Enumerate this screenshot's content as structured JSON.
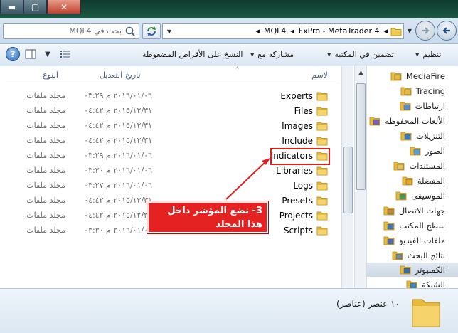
{
  "window": {
    "minimize_glyph": "▬",
    "maximize_glyph": "▢",
    "close_glyph": "✕"
  },
  "search": {
    "placeholder": "بحث في MQL4"
  },
  "address": {
    "crumbs": [
      "MQL4",
      "FxPro - MetaTrader 4"
    ],
    "separator": "◂"
  },
  "toolbar": {
    "organize": "تنظيم",
    "include_in_library": "تضمين في المكتبة",
    "share_with": "مشاركة مع",
    "burn": "النسخ على الأقراص المضغوطة"
  },
  "columns": {
    "name": "الاسم",
    "date_modified": "تاريخ التعديل",
    "type": "النوع",
    "sort_glyph": "^"
  },
  "files": [
    {
      "name": "Experts",
      "date": "٢٠١٦/٠١/٠٦ م ٠٣:٢٩",
      "type": "مجلد ملفات"
    },
    {
      "name": "Files",
      "date": "٢٠١٥/١٢/٣١ م ٠٤:٤٢",
      "type": "مجلد ملفات"
    },
    {
      "name": "Images",
      "date": "٢٠١٥/١٢/٣١ م ٠٤:٤٢",
      "type": "مجلد ملفات"
    },
    {
      "name": "Include",
      "date": "٢٠١٥/١٢/٣١ م ٠٤:٤٢",
      "type": "مجلد ملفات"
    },
    {
      "name": "Indicators",
      "date": "٢٠١٦/٠١/٠٦ م ٠٣:٢٩",
      "type": "مجلد ملفات"
    },
    {
      "name": "Libraries",
      "date": "٢٠١٦/٠١/٠٦ م ٠٣:٣٠",
      "type": "مجلد ملفات"
    },
    {
      "name": "Logs",
      "date": "٢٠١٦/٠١/٠٦ م ٠٣:٢٧",
      "type": "مجلد ملفات"
    },
    {
      "name": "Presets",
      "date": "٢٠١٥/١٢/٣١ م ٠٤:٤٢",
      "type": "مجلد ملفات"
    },
    {
      "name": "Projects",
      "date": "٢٠١٥/١٢/٣١ م ٠٤:٤٢",
      "type": "مجلد ملفات"
    },
    {
      "name": "Scripts",
      "date": "٢٠١٦/٠١/٠٦ م ٠٣:٣٠",
      "type": "مجلد ملفات"
    }
  ],
  "nav": [
    {
      "label": "MediaFire",
      "icon": "folder-icon"
    },
    {
      "label": "Tracing",
      "icon": "folder-icon"
    },
    {
      "label": "ارتباطات",
      "icon": "links-icon"
    },
    {
      "label": "الألعاب المحفوظة",
      "icon": "saved-games-icon"
    },
    {
      "label": "التنزيلات",
      "icon": "downloads-icon"
    },
    {
      "label": "الصور",
      "icon": "pictures-icon"
    },
    {
      "label": "المستندات",
      "icon": "documents-icon"
    },
    {
      "label": "المفضلة",
      "icon": "favorites-icon"
    },
    {
      "label": "الموسيقى",
      "icon": "music-icon"
    },
    {
      "label": "جهات الاتصال",
      "icon": "contacts-icon"
    },
    {
      "label": "سطح المكتب",
      "icon": "desktop-icon"
    },
    {
      "label": "ملفات الفيديو",
      "icon": "videos-icon"
    },
    {
      "label": "نتائج البحث",
      "icon": "search-results-icon"
    },
    {
      "label": "الكمبيوتر",
      "icon": "computer-icon"
    },
    {
      "label": "الشبكة",
      "icon": "network-icon"
    }
  ],
  "annotation": {
    "text": "3- نضع المؤشر داخل هذا المجلد",
    "color": "#e52222"
  },
  "details": {
    "item_count": "١٠ عنصر (عناصر)"
  },
  "colors": {
    "folder": "#f2c94c",
    "selection": "#cdd8e5",
    "highlight_border": "#e01e1e"
  }
}
